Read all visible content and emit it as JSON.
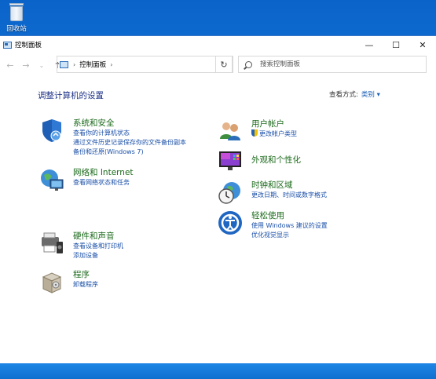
{
  "desktop": {
    "recycle_bin_label": "回收站"
  },
  "window": {
    "title": "控制面板",
    "controls": {
      "minimize": "—",
      "maximize": "☐",
      "close": "✕"
    }
  },
  "nav": {
    "back": "←",
    "forward": "→",
    "recent": "⌄",
    "up": "↑",
    "breadcrumb": "控制面板",
    "refresh": "↻",
    "search_placeholder": "搜索控制面板"
  },
  "content": {
    "heading": "调整计算机的设置",
    "view_by_label": "查看方式:",
    "view_by_value": "类别 ▾",
    "left_categories": [
      {
        "title": "系统和安全",
        "links": [
          "查看你的计算机状态",
          "通过文件历史记录保存你的文件备份副本",
          "备份和还原(Windows 7)"
        ]
      },
      {
        "title": "网络和 Internet",
        "links": [
          "查看网络状态和任务"
        ]
      },
      {
        "title": "硬件和声音",
        "links": [
          "查看设备和打印机",
          "添加设备"
        ]
      },
      {
        "title": "程序",
        "links": [
          "卸载程序"
        ]
      }
    ],
    "right_categories": [
      {
        "title": "用户帐户",
        "links": [
          "更改帐户类型"
        ]
      },
      {
        "title": "外观和个性化",
        "links": []
      },
      {
        "title": "时钟和区域",
        "links": [
          "更改日期、时间或数字格式"
        ]
      },
      {
        "title": "轻松使用",
        "links": [
          "使用 Windows 建议的设置",
          "优化视觉显示"
        ]
      }
    ]
  },
  "colors": {
    "title_green": "#1b6a1b",
    "link_blue": "#1a4fa8",
    "heading_blue": "#1e3287"
  }
}
